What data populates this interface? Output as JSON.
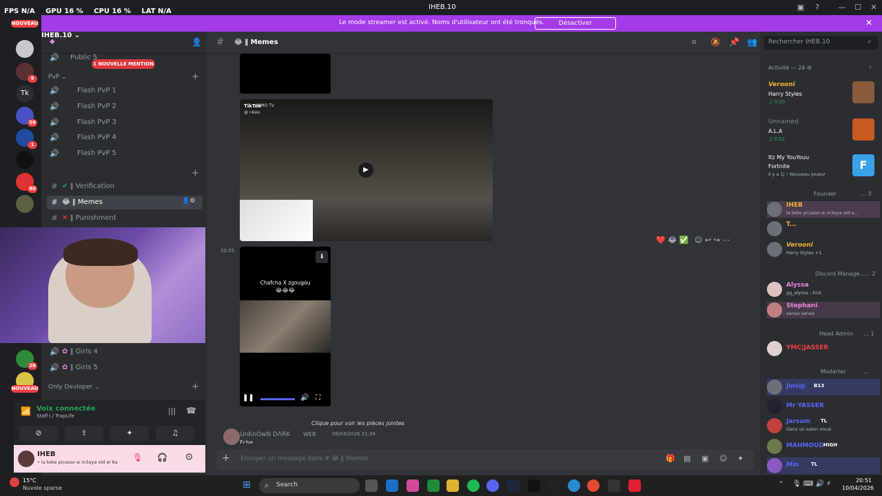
{
  "overlay": {
    "fps_label": "FPS",
    "fps_value": "N/A",
    "gpu_label": "GPU",
    "gpu_value": "16 %",
    "cpu_label": "CPU",
    "cpu_value": "16 %",
    "lat_label": "LAT",
    "lat_value": "N/A"
  },
  "window": {
    "title": "IHEB.10"
  },
  "banner": {
    "text": "Le mode streamer est activé. Noms d'utilisateur ont été tronqués.",
    "button": "Désactiver"
  },
  "servers": {
    "new_label": "NOUVEAU",
    "tk_label": "Tk",
    "badges": [
      "9",
      "59",
      "1",
      "80",
      "26"
    ]
  },
  "sidebar": {
    "server_name": "IHEB.10",
    "mention_pill": "1 NOUVELLE MENTION",
    "public_channel": "Public 5",
    "pvp_category": "PvP",
    "pvp_channels": [
      "Flash PvP 1",
      "Flash PvP 2",
      "Flash PvP 3",
      "Flash PvP 4",
      "Flash PvP 5"
    ],
    "text_channels": [
      "Verification",
      "Memes",
      "Punishment"
    ],
    "girls_channels": [
      "Girls 4",
      "Girls 5"
    ],
    "devloper_category": "Only Devloper"
  },
  "voice": {
    "status": "Voix connectée",
    "channel": "Staff I / TrapLife"
  },
  "user": {
    "name": "IHEB",
    "status": "• la bete picasso w m3aya old el 8a"
  },
  "channel": {
    "name": "Memes",
    "composer_placeholder": "Envoyer un message dans #",
    "composer_channel": "Memes"
  },
  "messages": {
    "tiktok_label": "TikTok",
    "tiktok_handle": "@ r4ien",
    "nimo_label": "NIMO TV",
    "timestamp": "20:55",
    "video_caption": "Chafcha X zgougou",
    "video_emojis": "😂😂😂",
    "reply_preview": "Clique pour voir les pièces jointes",
    "next_author": "UnKnOwN DΛRK",
    "next_tag": "WEB",
    "next_date": "08/04/2026 21:34",
    "next_text": "Fche"
  },
  "member_list": {
    "search_placeholder": "Rechercher IHEB.10",
    "activity_header": "Activité — 24",
    "activities": [
      {
        "name": "Verooni",
        "line1": "Harry Styles",
        "line2": "0:20"
      },
      {
        "name": "Unnamed",
        "line1": "A.L.A",
        "line2": "0:52"
      },
      {
        "name": "Itz My YouYouu",
        "line1": "Fortnite",
        "line2": "il y a 1j",
        "extra": "Nouveau joueur"
      }
    ],
    "groups": [
      {
        "title": "Founder",
        "count": "3",
        "members": [
          {
            "name": "IHEB",
            "status": "la bete picasso w m3aya old e...",
            "color": "#f0b232"
          },
          {
            "name": "T...",
            "status": "",
            "color": "#f0b232"
          },
          {
            "name": "Verooni",
            "status": "Harry Styles +1",
            "color": "#f0b232"
          }
        ]
      },
      {
        "title": "Discord Manage...",
        "count": "2",
        "members": [
          {
            "name": "Alyssa",
            "status": "gg_alyssa : kick",
            "color": "#e786d8"
          },
          {
            "name": "Stephani",
            "status": "sanaa sanaa",
            "color": "#e786d8"
          }
        ]
      },
      {
        "title": "Head Admin",
        "count": "1",
        "members": [
          {
            "name": "YMC|JASSER",
            "status": "",
            "color": "#f23f43"
          }
        ]
      },
      {
        "title": "Modarter",
        "count": "",
        "members": [
          {
            "name": "Jinsip",
            "status": "",
            "color": "#5865f2",
            "tag": "B13"
          },
          {
            "name": "Mr YASSER",
            "status": "",
            "color": "#5865f2"
          },
          {
            "name": "Jarsum",
            "status": "Dans un salon vocal",
            "color": "#5865f2",
            "tag": "TL"
          },
          {
            "name": "MAHMOUD",
            "status": "",
            "color": "#5865f2",
            "tag": "HIGH"
          },
          {
            "name": "Mio",
            "status": "",
            "color": "#5865f2",
            "tag": "TL"
          }
        ]
      }
    ]
  },
  "taskbar": {
    "temp": "15°C",
    "weather": "Nuvole sparse",
    "search": "Search",
    "time": "20:51",
    "date": "10/04/2026"
  }
}
